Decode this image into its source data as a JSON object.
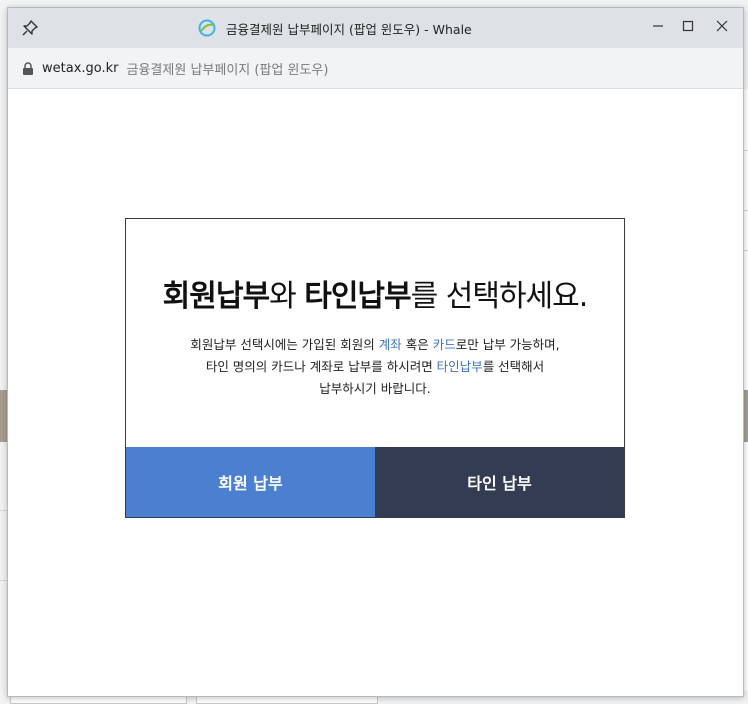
{
  "window": {
    "title": "금융결제원 납부페이지 (팝업 윈도우) - Whale",
    "domain": "wetax.go.kr",
    "page_title": "금융결제원 납부페이지 (팝업 윈도우)"
  },
  "modal": {
    "heading": {
      "part1": "회원납부",
      "part2": "와 ",
      "part3": "타인납부",
      "part4": "를 선택하세요."
    },
    "desc": {
      "l1a": "회원납부 선택시에는 가입된 회원의 ",
      "l1b": "계좌",
      "l1c": " 혹은 ",
      "l1d": "카드",
      "l1e": "로만 납부 가능하며,",
      "l2a": "타인 명의의 카드나 계좌로 납부를 하시려면 ",
      "l2b": "타인납부",
      "l2c": "를 선택해서",
      "l3": "납부하시기 바랍니다."
    },
    "buttons": {
      "member": "회원 납부",
      "other": "타인 납부"
    }
  },
  "colors": {
    "member_button": "#4b7fd0",
    "other_button": "#343c53",
    "highlight": "#3f73c6"
  }
}
